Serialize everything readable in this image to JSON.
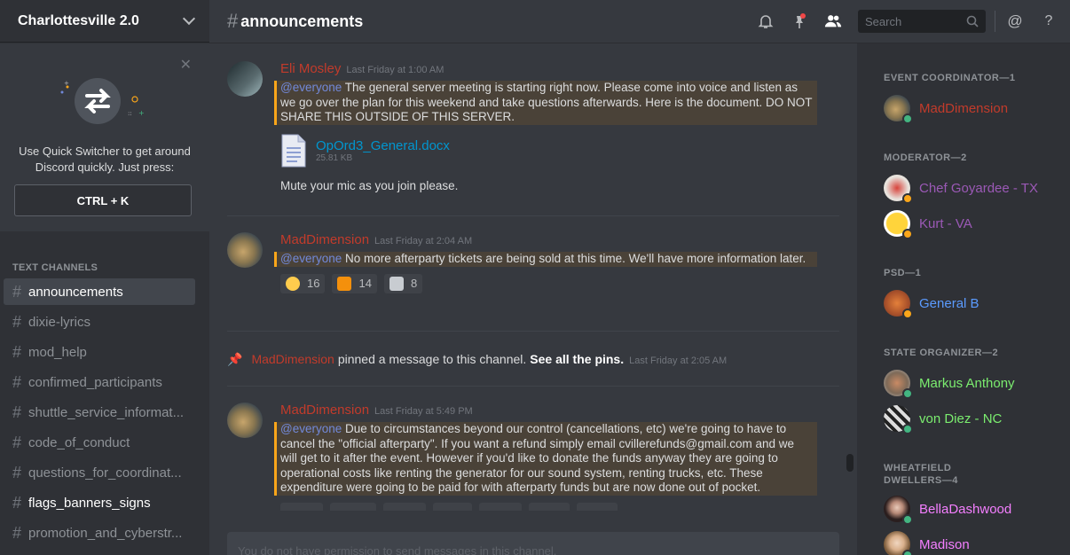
{
  "server": {
    "name": "Charlottesville 2.0"
  },
  "quick_switcher": {
    "text": "Use Quick Switcher to get around Discord quickly. Just press:",
    "shortcut": "CTRL + K",
    "close_icon": "close-icon"
  },
  "channels": {
    "category": "TEXT CHANNELS",
    "items": [
      {
        "label": "announcements",
        "state": "active"
      },
      {
        "label": "dixie-lyrics",
        "state": "normal"
      },
      {
        "label": "mod_help",
        "state": "normal"
      },
      {
        "label": "confirmed_participants",
        "state": "normal"
      },
      {
        "label": "shuttle_service_informat...",
        "state": "normal"
      },
      {
        "label": "code_of_conduct",
        "state": "normal"
      },
      {
        "label": "questions_for_coordinat...",
        "state": "normal"
      },
      {
        "label": "flags_banners_signs",
        "state": "unread"
      },
      {
        "label": "promotion_and_cyberstr...",
        "state": "normal"
      }
    ]
  },
  "header": {
    "channel": "announcements",
    "search_placeholder": "Search",
    "icons": [
      "bell-icon",
      "pin-icon",
      "members-icon",
      "search-icon",
      "mention-icon",
      "help-icon"
    ]
  },
  "messages": [
    {
      "author": "Eli Mosley",
      "time": "Last Friday at 1:00 AM",
      "mention": "@everyone",
      "text": " The general server meeting is starting right now. Please come into voice and listen as we go over the plan for this weekend and take questions afterwards. Here is the document. DO NOT SHARE THIS OUTSIDE OF THIS SERVER.",
      "attachment": {
        "name": "OpOrd3_General.docx",
        "size": "25.81 KB"
      },
      "followup": "Mute your mic as you join please."
    },
    {
      "author": "MadDimension",
      "time": "Last Friday at 2:04 AM",
      "mention": "@everyone",
      "text": " No more afterparty tickets are being sold at this time. We'll have more information later.",
      "reactions": [
        {
          "icon": "sad-face-icon",
          "count": "16"
        },
        {
          "icon": "sun-icon",
          "count": "14"
        },
        {
          "icon": "custom-emoji-icon",
          "count": "8"
        }
      ]
    },
    {
      "author": "MadDimension",
      "time": "Last Friday at 5:49 PM",
      "mention": "@everyone",
      "text": " Due to circumstances beyond our control (cancellations, etc) we're going to have to cancel the \"official afterparty\". If you want a refund simply email cvillerefunds@gmail.com and we will get to it after the event. However if you'd like to donate the funds anyway they are going to operational costs like renting the generator for our sound system, renting trucks, etc. These expenditure were going to be paid for with afterparty funds but are now done out of pocket."
    }
  ],
  "system_message": {
    "author": "MadDimension",
    "text": "pinned a message to this channel.",
    "link": "See all the pins.",
    "time": "Last Friday at 2:05 AM"
  },
  "composer": {
    "placeholder": "You do not have permission to send messages in this channel."
  },
  "members": {
    "groups": [
      {
        "title": "EVENT COORDINATOR—1",
        "members": [
          {
            "name": "MadDimension",
            "color": "#c23b2b",
            "status": "online"
          }
        ]
      },
      {
        "title": "MODERATOR—2",
        "members": [
          {
            "name": "Chef Goyardee - TX",
            "color": "#8e44ad",
            "status": "idle"
          },
          {
            "name": "Kurt - VA",
            "color": "#8e44ad",
            "status": "idle"
          }
        ]
      },
      {
        "title": "PSD—1",
        "members": [
          {
            "name": "General B",
            "color": "#4f8ef7",
            "status": "idle"
          }
        ]
      },
      {
        "title": "STATE ORGANIZER—2",
        "members": [
          {
            "name": "Markus Anthony",
            "color": "#7bed6f",
            "status": "online"
          },
          {
            "name": "von Diez - NC",
            "color": "#7bed6f",
            "status": "online"
          }
        ]
      },
      {
        "title": "WHEATFIELD DWELLERS—4",
        "members": [
          {
            "name": "BellaDashwood",
            "color": "#f47fff",
            "status": "online"
          },
          {
            "name": "Madison",
            "color": "#f47fff",
            "status": "online"
          }
        ]
      }
    ]
  }
}
